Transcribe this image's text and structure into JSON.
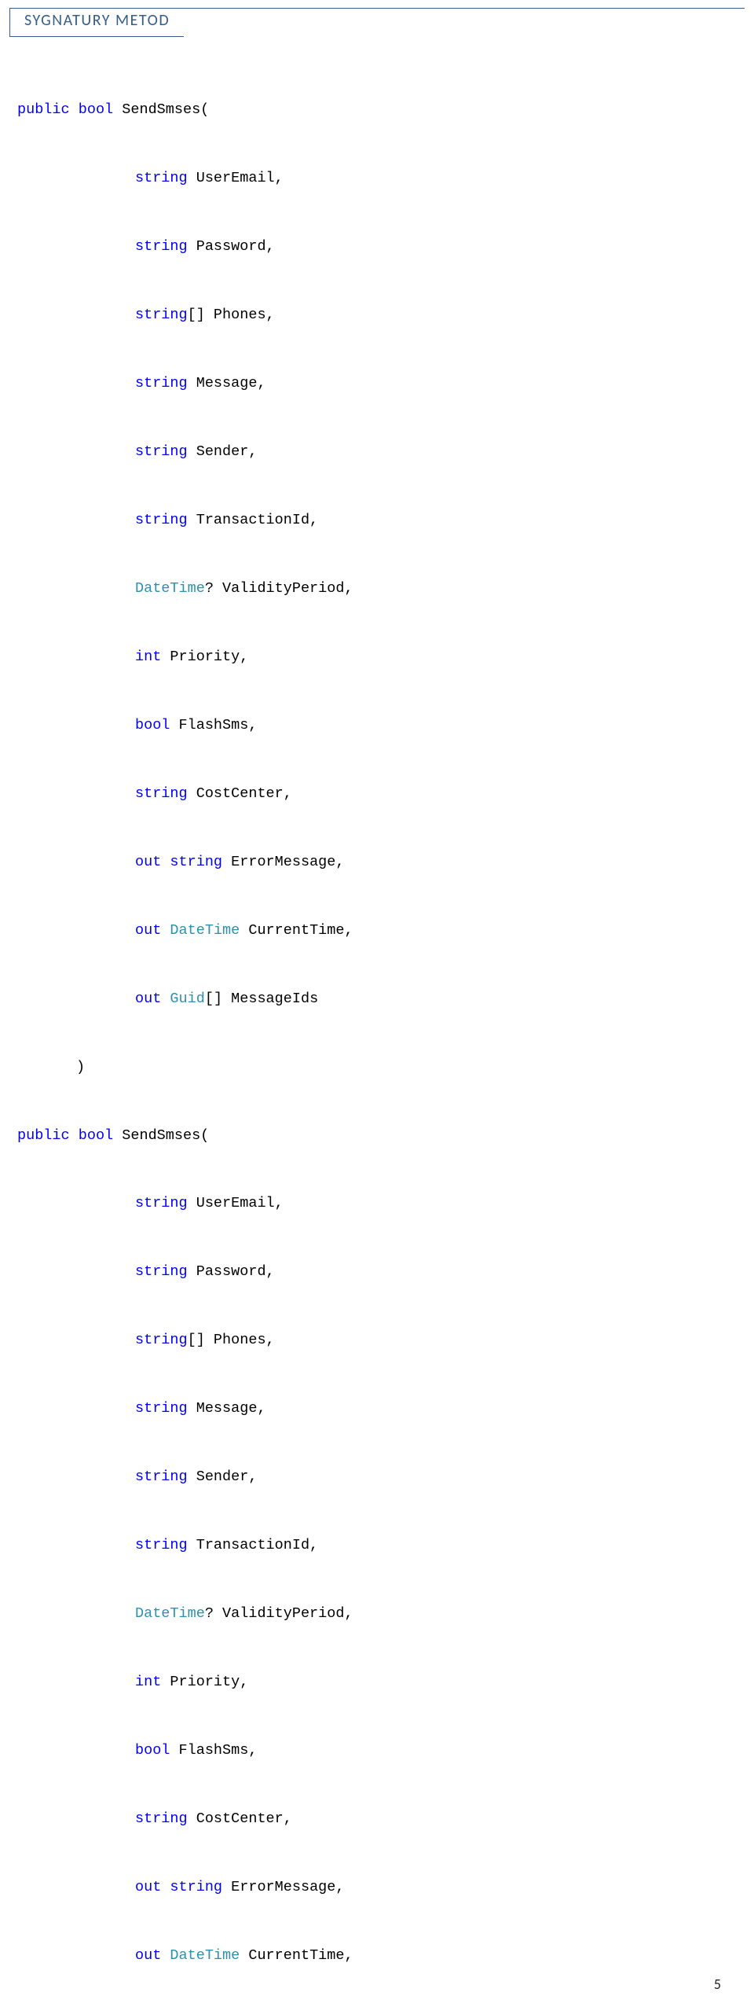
{
  "pageNumber": "5",
  "sectionTitle": "SYGNATURY METOD",
  "method1": {
    "decl_public": "public",
    "decl_bool": "bool",
    "decl_name": " SendSmses(",
    "params": [
      {
        "type": "string",
        "rest": " UserEmail,"
      },
      {
        "type": "string",
        "rest": " Password,"
      },
      {
        "type": "string",
        "rest": "[] Phones,"
      },
      {
        "type": "string",
        "rest": " Message,"
      },
      {
        "type": "string",
        "rest": " Sender,"
      },
      {
        "type": "string",
        "rest": " TransactionId,"
      },
      {
        "type": "DateTime",
        "rest": "? ValidityPeriod,"
      },
      {
        "type": "int",
        "rest": " Priority,"
      },
      {
        "type": "bool",
        "rest": " FlashSms,"
      },
      {
        "type": "string",
        "rest": " CostCenter,"
      },
      {
        "out": "out ",
        "type": "string",
        "rest": " ErrorMessage,"
      },
      {
        "out": "out ",
        "type": "DateTime",
        "rest": " CurrentTime,"
      },
      {
        "out": "out ",
        "type": "Guid",
        "rest": "[] MessageIds"
      }
    ],
    "close_paren": ")"
  },
  "method2": {
    "decl_public": "public",
    "decl_bool": "bool",
    "decl_name": " SendSmses(",
    "params": [
      {
        "type": "string",
        "rest": " UserEmail,"
      },
      {
        "type": "string",
        "rest": " Password,"
      },
      {
        "type": "string",
        "rest": "[] Phones,"
      },
      {
        "type": "string",
        "rest": " Message,"
      },
      {
        "type": "string",
        "rest": " Sender,"
      },
      {
        "type": "string",
        "rest": " TransactionId,"
      },
      {
        "type": "DateTime",
        "rest": "? ValidityPeriod,"
      },
      {
        "type": "int",
        "rest": " Priority,"
      },
      {
        "type": "bool",
        "rest": " FlashSms,"
      },
      {
        "type": "string",
        "rest": " CostCenter,"
      },
      {
        "out": "out ",
        "type": "string",
        "rest": " ErrorMessage,"
      },
      {
        "out": "out ",
        "type": "DateTime",
        "rest": " CurrentTime,"
      }
    ]
  }
}
